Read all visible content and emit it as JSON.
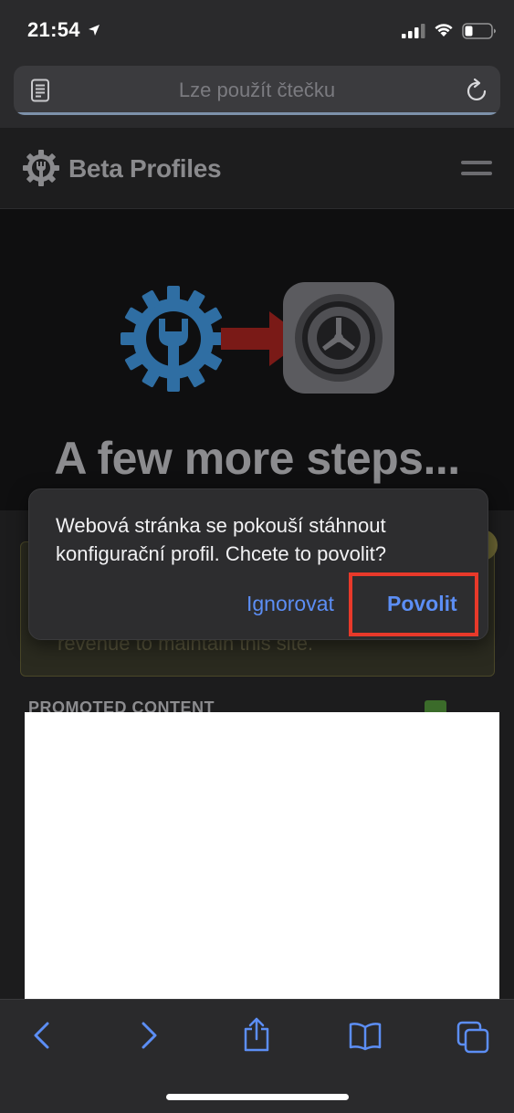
{
  "status_bar": {
    "time": "21:54",
    "icons": [
      "location-arrow-icon",
      "signal-icon",
      "wifi-icon",
      "battery-icon"
    ]
  },
  "address_bar": {
    "text": "Lze použít čtečku",
    "left_icon": "reader-icon",
    "right_icon": "reload-icon"
  },
  "site": {
    "title": "Beta Profiles",
    "logo_icon": "gear-wrench-icon",
    "menu_icon": "hamburger-menu-icon"
  },
  "hero": {
    "heading": "A few more steps..."
  },
  "content": {
    "notice_text": "revenue to maintain this site.",
    "promoted_label": "PROMOTED CONTENT"
  },
  "dialog": {
    "message": "Webová stránka se pokouší stáhnout konfigurační profil. Chcete to povolit?",
    "ignore_label": "Ignorovat",
    "allow_label": "Povolit",
    "highlight_color": "#e8392a",
    "button_color": "#5c8ef5"
  },
  "toolbar": {
    "items": [
      "back-icon",
      "forward-icon",
      "share-icon",
      "bookmarks-icon",
      "tabs-icon"
    ],
    "accent": "#5c8ef5"
  }
}
